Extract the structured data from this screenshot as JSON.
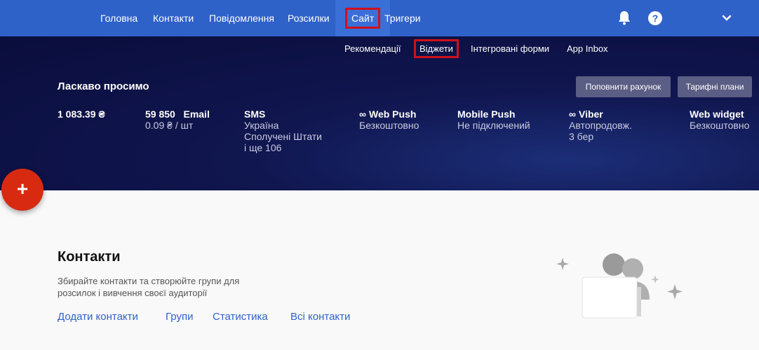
{
  "nav": {
    "items": [
      "Головна",
      "Контакти",
      "Повідомлення",
      "Розсилки",
      "Сайт",
      "Тригери"
    ],
    "help": "?"
  },
  "subnav": [
    "Рекомендації",
    "Віджети",
    "Інтегровані форми",
    "App Inbox"
  ],
  "hero": {
    "welcome": "Ласкаво просимо",
    "btn_topup": "Поповнити рахунок",
    "btn_plans": "Тарифні плани",
    "balance": "1 083.39 ₴",
    "email": {
      "title": "59 850   Email",
      "sub": "0.09 ₴ / шт"
    },
    "sms": {
      "title": "SMS",
      "l1": "Україна",
      "l2": "Сполучені Штати",
      "l3": "і ще 106"
    },
    "webpush": {
      "title": "Web Push",
      "sub": "Безкоштовно"
    },
    "mobilepush": {
      "title": "Mobile Push",
      "sub": "Не підключений"
    },
    "viber": {
      "title": "Viber",
      "l1": "Автопродовж.",
      "l2": "3 бер"
    },
    "webwidget": {
      "title": "Web widget",
      "sub": "Безкоштовно"
    },
    "infinity": "∞"
  },
  "fab": "+",
  "contacts": {
    "title": "Контакти",
    "desc": "Збирайте контакти та створюйте групи для розсилок і вивчення своєї аудиторії",
    "links": [
      "Додати контакти",
      "Групи",
      "Статистика",
      "Всі контакти"
    ]
  },
  "colors": {
    "nav_bg": "#2f62c9",
    "accent": "#2f62c9",
    "highlight": "#d0101a",
    "fab": "#d82a10"
  }
}
